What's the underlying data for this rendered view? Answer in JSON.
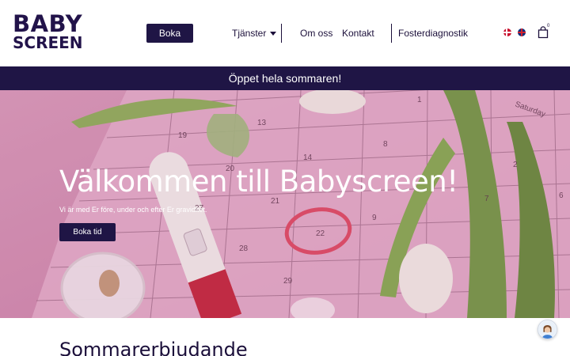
{
  "header": {
    "logo_line1": "BABY",
    "logo_line2": "SCREEN",
    "book_label": "Boka",
    "nav": {
      "services": "Tjänster",
      "about": "Om oss",
      "contact": "Kontakt",
      "fetal": "Fosterdiagnostik"
    },
    "cart_count": "0",
    "languages": [
      "danish-flag-icon",
      "english-flag-icon"
    ]
  },
  "announcement": "Öppet hela sommaren!",
  "hero": {
    "title": "Välkommen till Babyscreen!",
    "subtitle": "Vi är med Er före, under och efter Er graviditet.",
    "cta": "Boka tid",
    "calendar_numbers": [
      "1",
      "2",
      "6",
      "7",
      "8",
      "9",
      "13",
      "14",
      "19",
      "20",
      "21",
      "22",
      "27",
      "28",
      "29"
    ],
    "calendar_day": "Saturday"
  },
  "offers": {
    "heading": "Sommarerbjudande"
  },
  "colors": {
    "brand": "#1f1545",
    "hero_pink": "#d18fb0"
  }
}
